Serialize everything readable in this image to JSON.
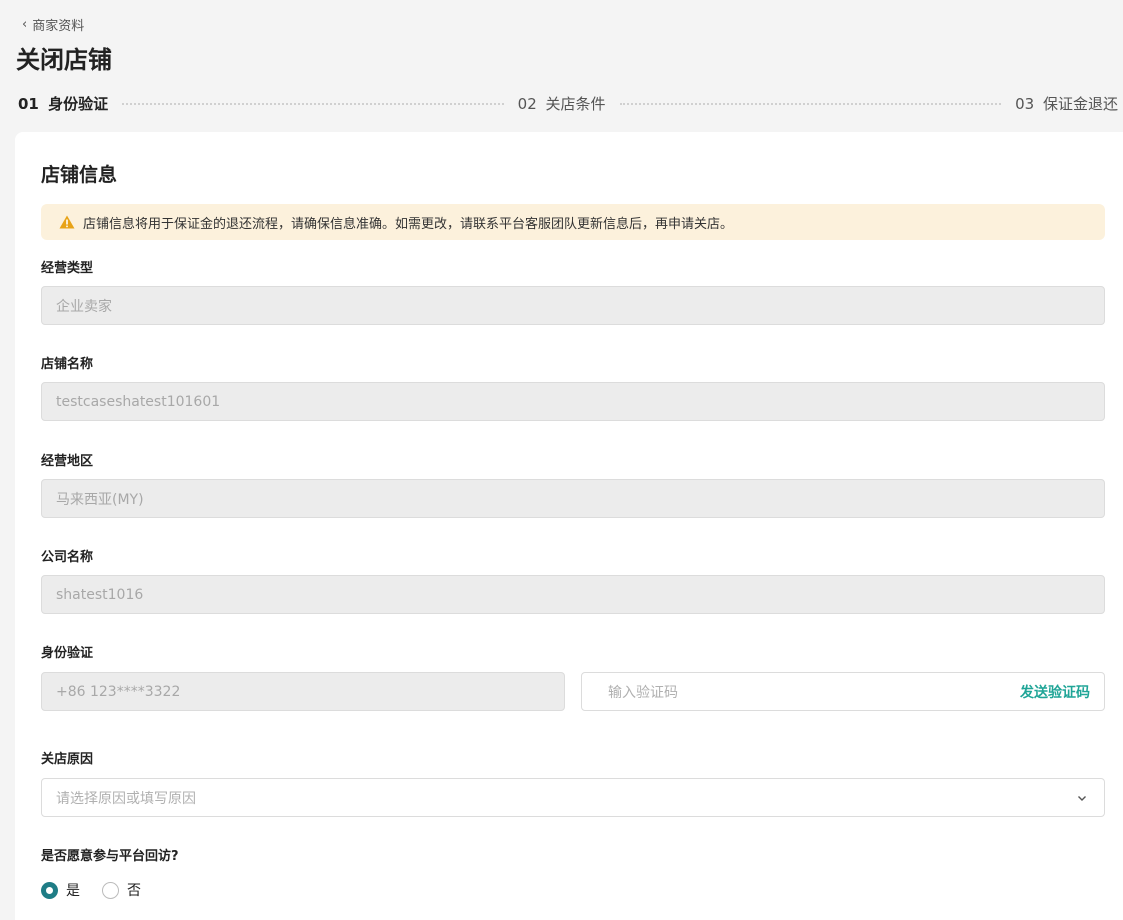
{
  "header": {
    "back_label": "商家资料",
    "title": "关闭店铺"
  },
  "stepper": {
    "steps": [
      {
        "num": "01",
        "label": "身份验证",
        "active": true
      },
      {
        "num": "02",
        "label": "关店条件",
        "active": false
      },
      {
        "num": "03",
        "label": "保证金退还",
        "active": false
      }
    ]
  },
  "card": {
    "title": "店铺信息",
    "notice": "店铺信息将用于保证金的退还流程，请确保信息准确。如需更改，请联系平台客服团队更新信息后，再申请关店。"
  },
  "fields": {
    "business_type": {
      "label": "经营类型",
      "value": "企业卖家"
    },
    "shop_name": {
      "label": "店铺名称",
      "value": "testcaseshatest101601"
    },
    "region": {
      "label": "经营地区",
      "value": "马来西亚(MY)"
    },
    "company_name": {
      "label": "公司名称",
      "value": "shatest1016"
    },
    "identity": {
      "label": "身份验证",
      "phone": "+86 123****3322",
      "code_placeholder": "输入验证码",
      "send_code_label": "发送验证码"
    },
    "close_reason": {
      "label": "关店原因",
      "placeholder": "请选择原因或填写原因"
    },
    "revisit": {
      "label": "是否愿意参与平台回访?",
      "options": [
        {
          "label": "是",
          "checked": true
        },
        {
          "label": "否",
          "checked": false
        }
      ]
    }
  },
  "colors": {
    "accent": "#1fa597",
    "radio_checked": "#1f7d86",
    "notice_bg": "#fcf1dc",
    "warning": "#e8a317"
  }
}
